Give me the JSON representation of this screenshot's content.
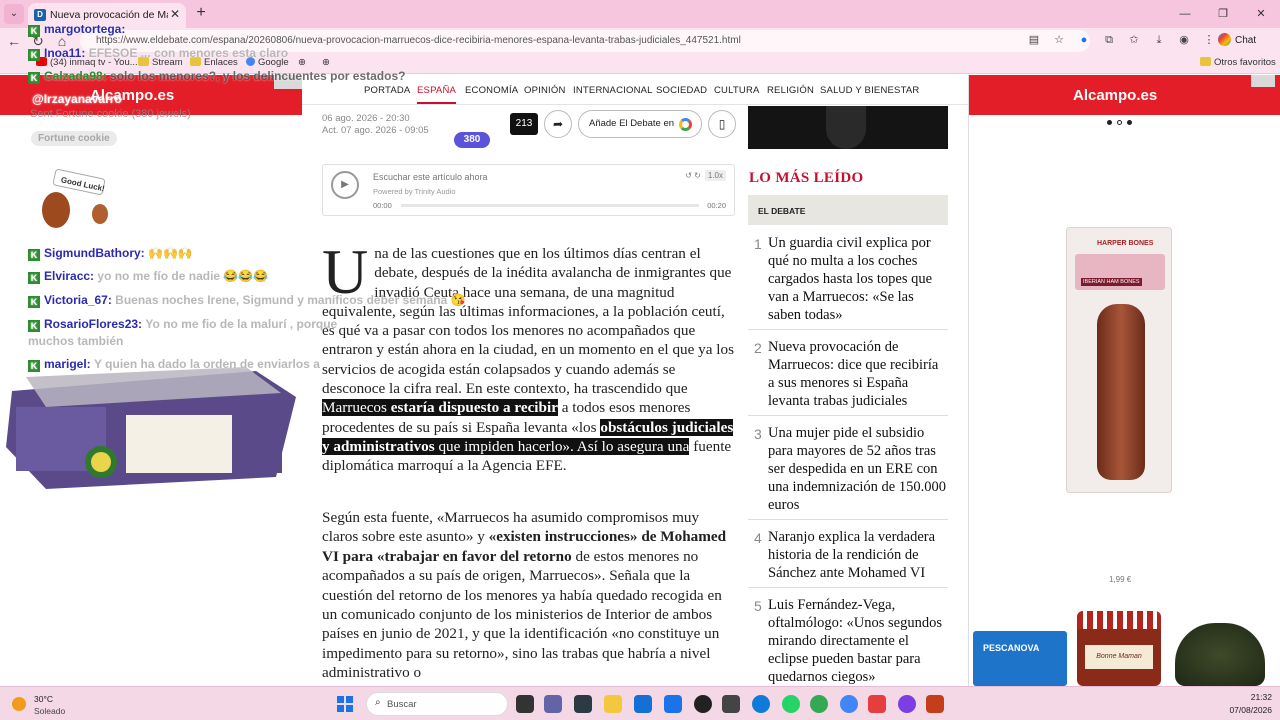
{
  "browser": {
    "tab_title": "Nueva provocación de Marruecos: ...",
    "url": "https://www.eldebate.com/espana/20260806/nueva-provocacion-marruecos-dice-recibiria-menores-espana-levanta-trabas-judiciales_447521.html",
    "chat_label": "Chat",
    "bookmarks": [
      "(34) inmaq tv - You...",
      "Stream",
      "Enlaces",
      "Google"
    ],
    "other_bookmarks": "Otros favoritos"
  },
  "chat": {
    "lines": [
      {
        "user": "margotortega:",
        "msg": ""
      },
      {
        "user": "Inoa11:",
        "msg": "EFESOE ... con menores esta claro"
      },
      {
        "user": "Calzada98:",
        "msg": "solo los menores?, y los delincuentes por estados?"
      },
      {
        "user": "@Irzayanavarro",
        "msg": ""
      }
    ],
    "fortune_line": "Sent Fortune cookie (380 jewels)",
    "fortune_pill": "Fortune cookie",
    "good_luck": "Good Luck!",
    "lines2": [
      {
        "user": "SigmundBathory:",
        "msg": "🙌🙌🙌"
      },
      {
        "user": "Elviracc:",
        "msg": "yo no me fío de nadie 😂😂😂"
      },
      {
        "user": "Victoria_67:",
        "msg": "Buenas noches Irene, Sigmund y maníficos deber semana 😘"
      },
      {
        "user": "RosarioFlores23:",
        "msg": "Yo no me fio de la malurí , porque"
      },
      {
        "user": "",
        "msg": "muchos también"
      },
      {
        "user": "marigel:",
        "msg": "Y quien ha dado la orden de enviarlos a"
      }
    ]
  },
  "left_ad": {
    "logo": "Alcampo.es"
  },
  "site_nav": [
    "PORTADA",
    "ESPAÑA",
    "ECONOMÍA",
    "OPINIÓN",
    "INTERNACIONAL",
    "SOCIEDAD",
    "CULTURA",
    "RELIGIÓN",
    "SALUD Y BIENESTAR"
  ],
  "article": {
    "date": "06 ago. 2026 - 20:30",
    "updated": "Act. 07 ago. 2026 - 09:05",
    "comments_count": "213",
    "badge_count": "380",
    "google_btn": "Añade El Debate en",
    "audio_label": "Escuchar este artículo ahora",
    "audio_powered": "Powered by Trinity Audio",
    "audio_start": "00:00",
    "audio_end": "00:20",
    "audio_speed": "1.0x",
    "dropcap": "U",
    "p1_a": "na de las cuestiones que en los últimos días centran el debate, después de la inédita avalancha de inmigrantes que invadió Ceuta hace una semana, de una magnitud equivalente, según las últimas informaciones, a la población ceutí, es qué va a pasar con todos los menores no acompañados que entraron y están ahora en la ciudad, en un momento en el que ya los servicios de acogida están colapsados y cuando además se desconoce la cifra real. En este contexto, ha trascendido que ",
    "p1_hl1": "Marruecos ",
    "p1_hl1b": "estaría dispuesto a recibir",
    "p1_b": " a todos esos menores procedentes de su país si España levanta «los ",
    "p1_hl2": "obstáculos judiciales y administrativos",
    "p1_c": " que impiden hacerlo». Así lo asegura una",
    "p1_d": " fuente diplomática marroquí a la Agencia EFE.",
    "p2_a": "Según esta fuente, «Marruecos ha asumido compromisos muy claros sobre este asunto» y ",
    "p2_bold": "«existen instrucciones» de Mohamed VI para «trabajar en favor del retorno",
    "p2_b": " de estos menores no acompañados a su país de origen, Marruecos». Señala que la cuestión del retorno de los menores ya había quedado recogida en un comunicado conjunto de los ministerios de Interior de ambos países en junio de 2021, y que la identificación «no constituye un impedimento para su retorno», sino las trabas que habría a nivel administrativo o"
  },
  "sidebar": {
    "most_read_title": "LO MÁS LEÍDO",
    "tab_label": "EL DEBATE",
    "items": [
      {
        "n": "1",
        "title": "Un guardia civil explica por qué no multa a los coches cargados hasta los topes que van a Marruecos: «Se las saben todas»"
      },
      {
        "n": "2",
        "title": "Nueva provocación de Marruecos: dice que recibiría a sus menores si España levanta trabas judiciales"
      },
      {
        "n": "3",
        "title": "Una mujer pide el subsidio para mayores de 52 años tras ser despedida en un ERE con una indemnización de 150.000 euros"
      },
      {
        "n": "4",
        "title": "Naranjo explica la verdadera historia de la rendición de Sánchez ante Mohamed VI"
      },
      {
        "n": "5",
        "title": "Luis Fernández-Vega, oftalmólogo: «Unos segundos mirando directamente el eclipse pueden bastar para quedarnos ciegos»"
      }
    ]
  },
  "right_ad": {
    "logo": "Alcampo.es",
    "box_brand": "HARPER BONES",
    "box_label": "IBERIAN HAM BONES",
    "price": "1,99 €",
    "pescanova": "PESCANOVA",
    "jar_label": "Bonne Maman"
  },
  "taskbar": {
    "temp": "30°C",
    "condition": "Soleado",
    "search": "Buscar",
    "time": "21:32",
    "date": "07/08/2026"
  }
}
